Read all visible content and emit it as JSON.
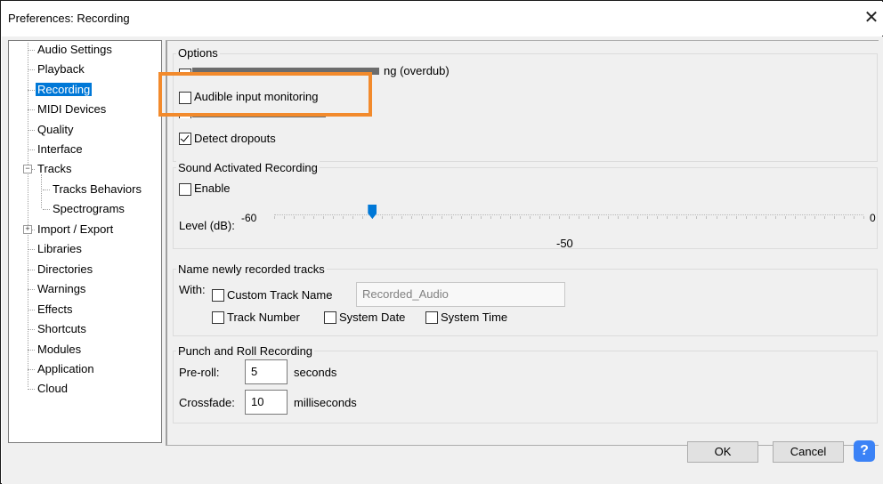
{
  "window": {
    "title": "Preferences: Recording",
    "close_glyph": "✕"
  },
  "tree": {
    "items": [
      {
        "label": "Audio Settings"
      },
      {
        "label": "Playback"
      },
      {
        "label": "Recording",
        "selected": true
      },
      {
        "label": "MIDI Devices"
      },
      {
        "label": "Quality"
      },
      {
        "label": "Interface"
      },
      {
        "label": "Tracks",
        "expander": "−"
      },
      {
        "label": "Tracks Behaviors"
      },
      {
        "label": "Spectrograms"
      },
      {
        "label": "Import / Export",
        "expander": "+"
      },
      {
        "label": "Libraries"
      },
      {
        "label": "Directories"
      },
      {
        "label": "Warnings"
      },
      {
        "label": "Effects"
      },
      {
        "label": "Shortcuts"
      },
      {
        "label": "Modules"
      },
      {
        "label": "Application"
      },
      {
        "label": "Cloud"
      }
    ]
  },
  "options": {
    "title": "Options",
    "overdub_visible_fragment": "ng (overdub)",
    "audible_label": "Audible input monitoring",
    "detect_label": "Detect dropouts",
    "overdub_checked": false,
    "audible_checked": false,
    "detect_checked": true
  },
  "sound_activated": {
    "title": "Sound Activated Recording",
    "enable_label": "Enable",
    "enable_checked": false,
    "level_label": "Level (dB):",
    "min_label": "-60",
    "max_label": "0",
    "value_label": "-50",
    "value": -50,
    "min": -60,
    "max": 0
  },
  "naming": {
    "title": "Name newly recorded tracks",
    "with_label": "With:",
    "custom_label": "Custom Track Name",
    "custom_value": "Recorded_Audio",
    "track_number_label": "Track Number",
    "system_date_label": "System Date",
    "system_time_label": "System Time"
  },
  "punch": {
    "title": "Punch and Roll Recording",
    "preroll_label": "Pre-roll:",
    "preroll_value": "5",
    "preroll_unit": "seconds",
    "crossfade_label": "Crossfade:",
    "crossfade_value": "10",
    "crossfade_unit": "milliseconds"
  },
  "buttons": {
    "ok": "OK",
    "cancel": "Cancel",
    "help": "?"
  },
  "colors": {
    "selection": "#0078d7",
    "highlight": "#f28a2c"
  }
}
